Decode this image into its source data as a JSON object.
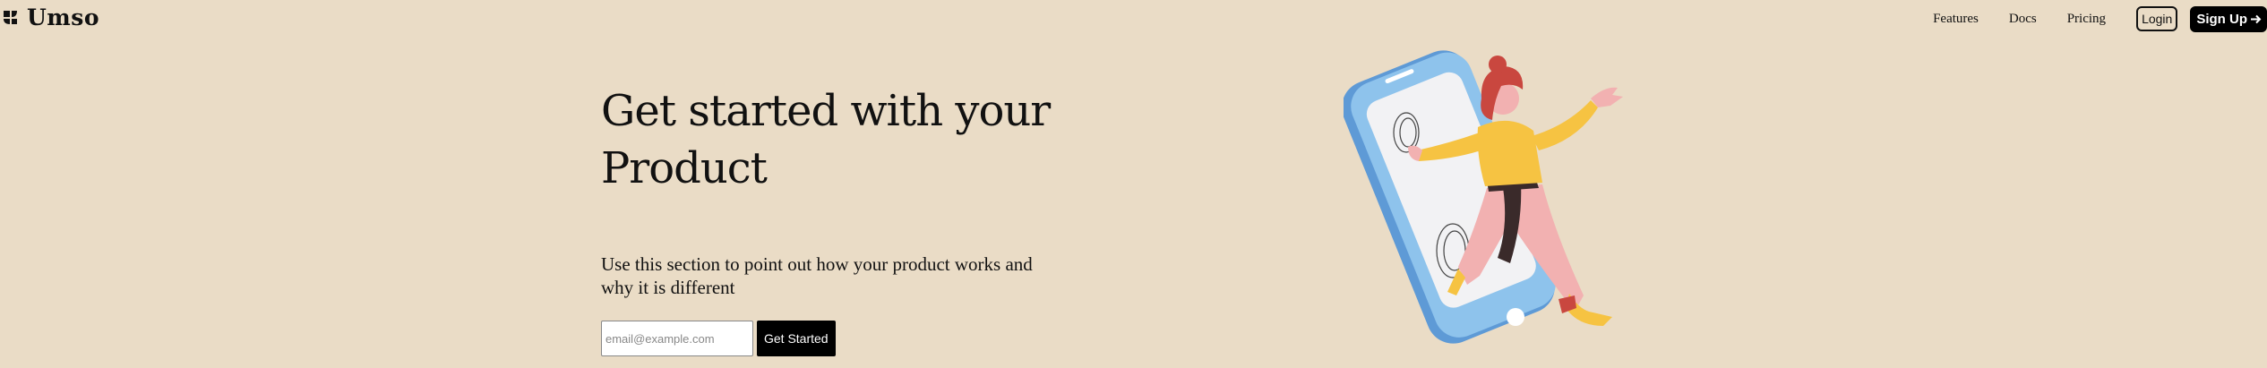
{
  "brand": {
    "name": "Umso"
  },
  "nav": {
    "links": [
      "Features",
      "Docs",
      "Pricing"
    ],
    "login_label": "Login",
    "signup_label": "Sign Up",
    "signup_icon": "arrow-right-icon"
  },
  "hero": {
    "title": "Get started with your Product",
    "description": "Use this section to point out how your product works and why it is different",
    "email_placeholder": "email@example.com",
    "cta_label": "Get Started"
  },
  "colors": {
    "background": "#eadcc6",
    "primary": "#000000",
    "phone": "#8ec3ec",
    "shirt": "#f6c342",
    "pants": "#f2b1b1",
    "hair": "#c9473f"
  }
}
